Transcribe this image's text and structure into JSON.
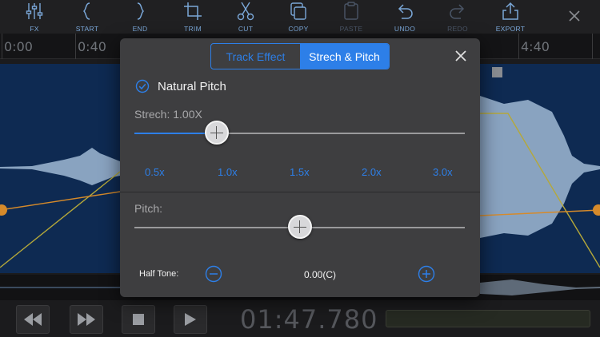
{
  "toolbar": {
    "items": [
      {
        "label": "FX",
        "icon": "sliders-icon"
      },
      {
        "label": "START",
        "icon": "left-brace-icon"
      },
      {
        "label": "END",
        "icon": "right-brace-icon"
      },
      {
        "label": "TRIM",
        "icon": "crop-icon"
      },
      {
        "label": "CUT",
        "icon": "scissors-icon"
      },
      {
        "label": "COPY",
        "icon": "copy-icon"
      },
      {
        "label": "PASTE",
        "icon": "paste-icon"
      },
      {
        "label": "UNDO",
        "icon": "undo-icon"
      },
      {
        "label": "REDO",
        "icon": "redo-icon"
      },
      {
        "label": "EXPORT",
        "icon": "share-icon"
      }
    ],
    "close_icon": "close-icon"
  },
  "ruler": {
    "labels": [
      "0:00",
      "0:40",
      "4:40"
    ]
  },
  "colors": {
    "accent": "#2d7fe8",
    "wave_bg": "#0e2a52",
    "wave": "#9fb8d4",
    "envelope_yellow": "#b5a83a",
    "envelope_orange": "#d68a2a"
  },
  "modal": {
    "tabs": [
      {
        "label": "Track Effect",
        "active": false
      },
      {
        "label": "Strech & Pitch",
        "active": true
      }
    ],
    "natural_pitch": {
      "label": "Natural Pitch",
      "checked": true
    },
    "stretch": {
      "label": "Strech: 1.00X",
      "value_fraction": 0.25,
      "speeds": [
        "0.5x",
        "1.0x",
        "1.5x",
        "2.0x",
        "3.0x"
      ]
    },
    "pitch": {
      "label": "Pitch:",
      "value_fraction": 0.5
    },
    "half_tone": {
      "label": "Half Tone:",
      "value": "0.00(C)"
    }
  },
  "transport": {
    "timecode": "01:47.780",
    "buttons": [
      "rewind-icon",
      "fast-forward-icon",
      "stop-icon",
      "play-icon"
    ]
  }
}
